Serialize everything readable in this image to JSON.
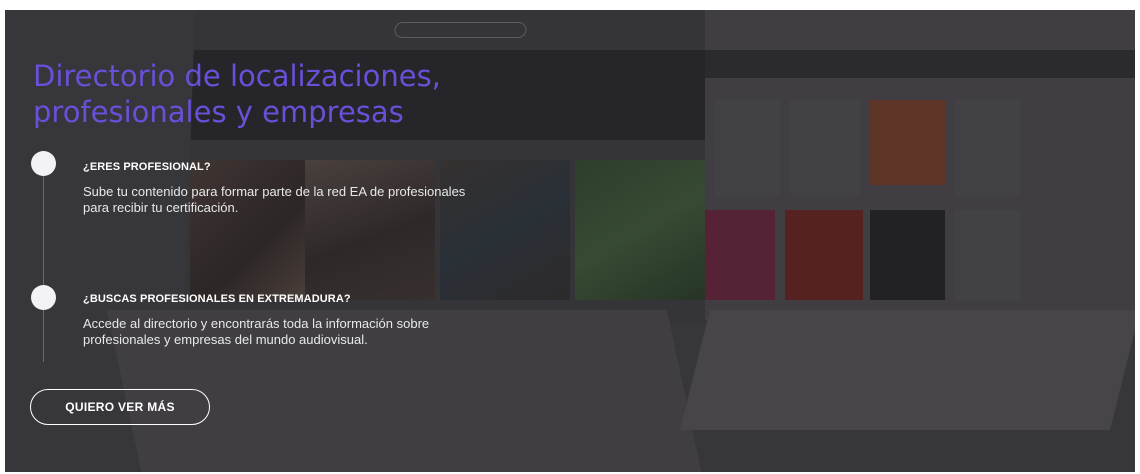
{
  "hero": {
    "heading_line1": "Directorio de localizaciones,",
    "heading_line2": "profesionales y empresas",
    "items": [
      {
        "title": "¿ERES PROFESIONAL?",
        "text": "Sube tu contenido para formar parte de la red EA de profesionales para recibir tu certificación."
      },
      {
        "title": "¿BUSCAS PROFESIONALES EN EXTREMADURA?",
        "text": "Accede al directorio y encontrarás toda la información sobre profesionales y empresas del mundo audiovisual."
      }
    ],
    "cta_label": "QUIERO VER MÁS"
  },
  "colors": {
    "heading": "#6a4fd8",
    "overlay": "#3d3c40",
    "dot": "#f3f3f6"
  }
}
